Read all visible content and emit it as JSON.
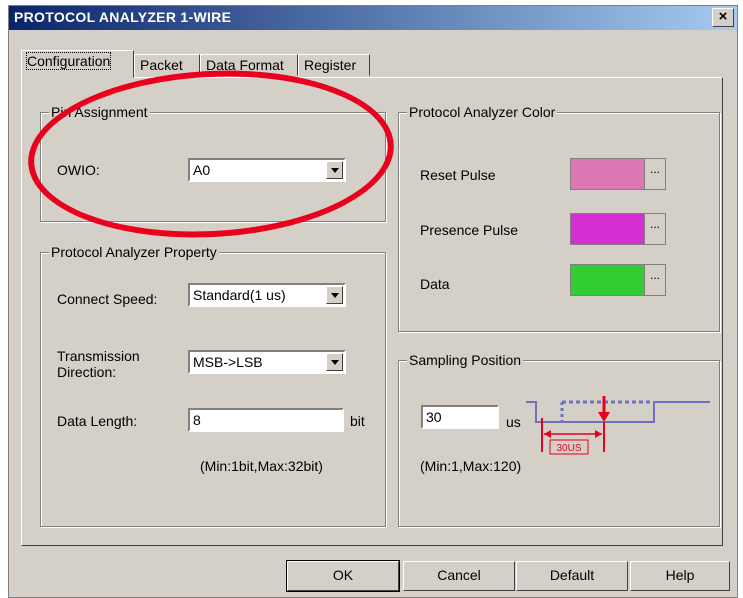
{
  "window": {
    "title": "PROTOCOL ANALYZER 1-WIRE",
    "close_label": "×"
  },
  "tabs": [
    {
      "label": "Configuration"
    },
    {
      "label": "Packet"
    },
    {
      "label": "Data Format"
    },
    {
      "label": "Register"
    }
  ],
  "pin_assignment": {
    "legend": "Pin Assignment",
    "owio_label": "OWIO:",
    "owio_value": "A0"
  },
  "property": {
    "legend": "Protocol Analyzer Property",
    "connect_speed_label": "Connect Speed:",
    "connect_speed_value": "Standard(1 us)",
    "transmission_label_1": "Transmission",
    "transmission_label_2": "Direction:",
    "transmission_value": "MSB->LSB",
    "data_length_label": "Data Length:",
    "data_length_value": "8",
    "data_length_unit": "bit",
    "data_length_range": "(Min:1bit,Max:32bit)"
  },
  "color": {
    "legend": "Protocol Analyzer Color",
    "reset_label": "Reset Pulse",
    "reset_color": "#db77b4",
    "presence_label": "Presence Pulse",
    "presence_color": "#d42fd2",
    "data_label": "Data",
    "data_color": "#33cc33",
    "browse_label": "..."
  },
  "sampling": {
    "legend": "Sampling Position",
    "value": "30",
    "unit": "us",
    "range": "(Min:1,Max:120)",
    "diagram_label": "30US"
  },
  "buttons": {
    "ok": "OK",
    "cancel": "Cancel",
    "default": "Default",
    "help": "Help"
  }
}
